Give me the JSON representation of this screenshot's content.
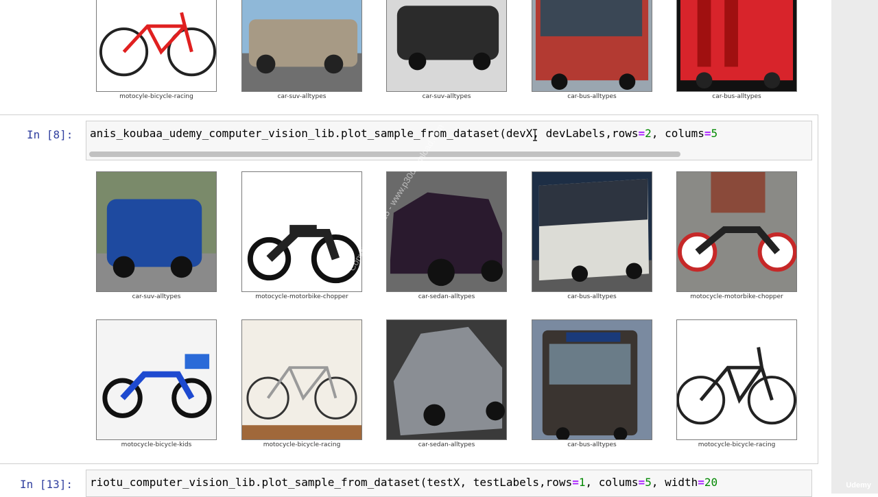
{
  "cells": {
    "previous_output_captions": [
      "motocyle-bicycle-racing",
      "car-suv-alltypes",
      "car-suv-alltypes",
      "car-bus-alltypes",
      "car-bus-alltypes"
    ],
    "cell8": {
      "prompt": "In [8]:",
      "code_prefix": "anis_koubaa_udemy_computer_vision_lib.plot_sample_from_dataset(devX, devLabels,rows",
      "eq1": "=",
      "rows": "2",
      "mid": ", colums",
      "eq2": "=",
      "cols": "5",
      "captions_row1": [
        "car-suv-alltypes",
        "motocycle-motorbike-chopper",
        "car-sedan-alltypes",
        "car-bus-alltypes",
        "motocycle-motorbike-chopper"
      ],
      "captions_row2": [
        "motocycle-bicycle-kids",
        "motocycle-bicycle-racing",
        "car-sedan-alltypes",
        "car-bus-alltypes",
        "motocycle-bicycle-racing"
      ]
    },
    "cell13": {
      "prompt": "In [13]:",
      "code_prefix": "riotu_computer_vision_lib.plot_sample_from_dataset(testX, testLabels,rows",
      "eq1": "=",
      "rows": "1",
      "mid": ", colums",
      "eq2": "=",
      "cols": "5",
      "mid2": ", width",
      "eq3": "=",
      "width": "20"
    }
  },
  "watermark": "Copyright © 2025 - www.p30download.com",
  "brand": "Udemy"
}
